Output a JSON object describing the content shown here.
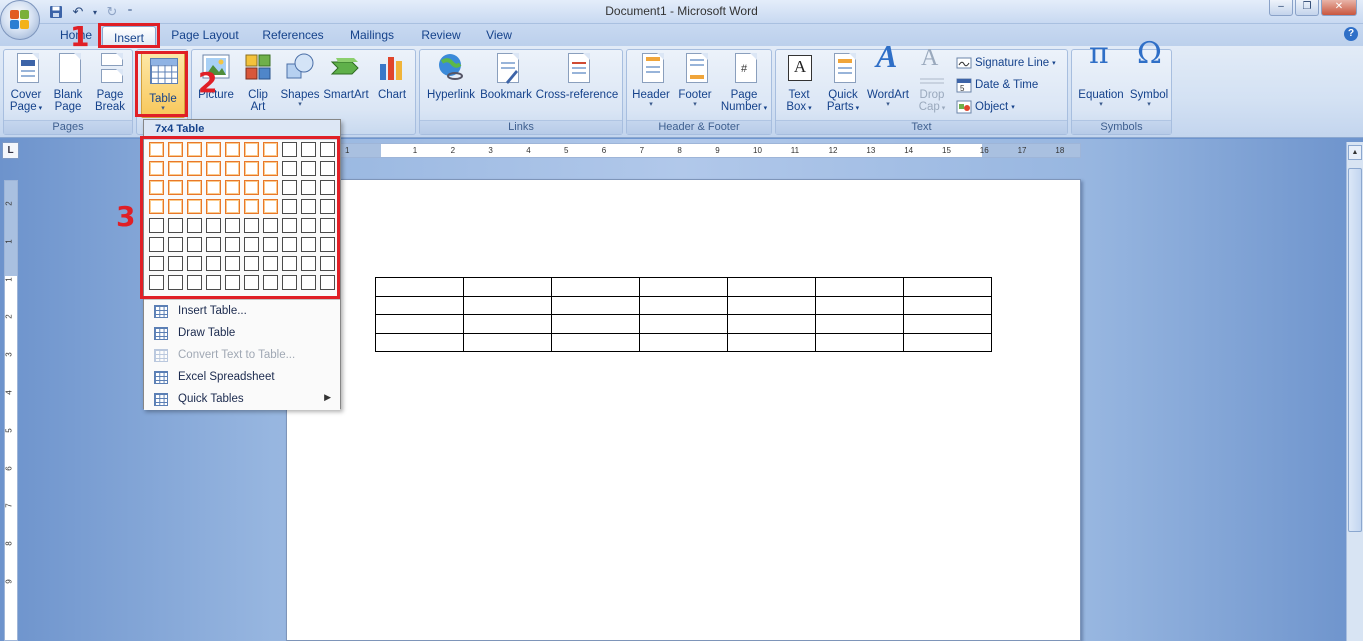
{
  "window": {
    "title": "Document1 - Microsoft Word",
    "minimize": "–",
    "restore": "❐",
    "close": "✕"
  },
  "qat": {
    "save_icon": "save-icon",
    "undo_icon": "undo-icon",
    "redo_icon": "redo-icon",
    "customize_icon": "customize-icon"
  },
  "tabs": [
    "Home",
    "Insert",
    "Page Layout",
    "References",
    "Mailings",
    "Review",
    "View"
  ],
  "help": "?",
  "ribbon": {
    "pages": {
      "label": "Pages",
      "cover": [
        "Cover",
        "Page"
      ],
      "blank": [
        "Blank",
        "Page"
      ],
      "break": [
        "Page",
        "Break"
      ]
    },
    "tables": {
      "table": "Table"
    },
    "illustrations": {
      "picture": "Picture",
      "clipart": [
        "Clip",
        "Art"
      ],
      "shapes": "Shapes",
      "smartart": "SmartArt",
      "chart": "Chart"
    },
    "links": {
      "label": "Links",
      "hyperlink": "Hyperlink",
      "bookmark": "Bookmark",
      "crossref": "Cross-reference"
    },
    "headerfooter": {
      "label": "Header & Footer",
      "header": "Header",
      "footer": "Footer",
      "pagenumber": [
        "Page",
        "Number"
      ]
    },
    "text": {
      "label": "Text",
      "textbox": [
        "Text",
        "Box"
      ],
      "quickparts": [
        "Quick",
        "Parts"
      ],
      "wordart": "WordArt",
      "dropcap": [
        "Drop",
        "Cap"
      ],
      "signature": "Signature Line",
      "datetime": "Date & Time",
      "object": "Object"
    },
    "symbols": {
      "label": "Symbols",
      "equation": "Equation",
      "symbol": "Symbol"
    }
  },
  "ruler_numbers": [
    "1",
    "1",
    "2",
    "3",
    "4",
    "5",
    "6",
    "7",
    "8",
    "9",
    "10",
    "11",
    "12",
    "13",
    "14",
    "15",
    "16",
    "17",
    "18"
  ],
  "vruler_numbers": [
    "2",
    "1",
    "1",
    "2",
    "3",
    "4",
    "5",
    "6",
    "7",
    "8",
    "9"
  ],
  "ruler_corner": "L",
  "table_menu": {
    "header": "7x4 Table",
    "grid": {
      "cols": 10,
      "rows": 8,
      "highlight_cols": 7,
      "highlight_rows": 4
    },
    "items": [
      {
        "label": "Insert Table...",
        "disabled": false,
        "submenu": false
      },
      {
        "label": "Draw Table",
        "disabled": false,
        "submenu": false
      },
      {
        "label": "Convert Text to Table...",
        "disabled": true,
        "submenu": false
      },
      {
        "label": "Excel Spreadsheet",
        "disabled": false,
        "submenu": false
      },
      {
        "label": "Quick Tables",
        "disabled": false,
        "submenu": true
      }
    ]
  },
  "document_table": {
    "cols": 7,
    "rows": 4
  },
  "annotations": {
    "step1": "1",
    "step2": "2",
    "step3": "3",
    "color": "#e01f26"
  }
}
